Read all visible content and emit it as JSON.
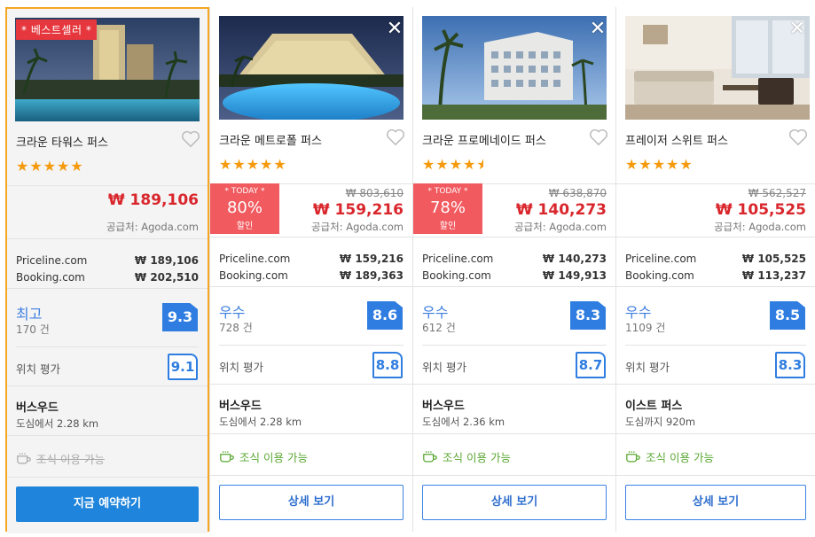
{
  "colors": {
    "accent": "#2f7de1",
    "price": "#d9262c",
    "highlight_border": "#f5a623",
    "today_badge": "#f15a5f",
    "breakfast": "#5aa832"
  },
  "hotels": [
    {
      "ribbon": "* 베스트셀러 *",
      "name": "크라운 타워스 퍼스",
      "stars": "★★★★★",
      "price_now": "₩ 189,106",
      "supplier": "공급처: Agoda.com",
      "comparisons": [
        {
          "site": "Priceline.com",
          "price": "₩ 189,106"
        },
        {
          "site": "Booking.com",
          "price": "₩ 202,510"
        }
      ],
      "rating_label": "최고",
      "review_count": "170 건",
      "score": "9.3",
      "location_label": "위치 평가",
      "location_score": "9.1",
      "area": "버스우드",
      "distance": "도심에서 2.28 km",
      "breakfast": "조식 이용 가능",
      "button": "지금 예약하기"
    },
    {
      "name": "크라운 메트로폴 퍼스",
      "stars": "★★★★★",
      "today_label": "* TODAY *",
      "discount": "80%",
      "discount_word": "할인",
      "price_old": "₩ 803,610",
      "price_now": "₩ 159,216",
      "supplier": "공급처: Agoda.com",
      "comparisons": [
        {
          "site": "Priceline.com",
          "price": "₩ 159,216"
        },
        {
          "site": "Booking.com",
          "price": "₩ 189,363"
        }
      ],
      "rating_label": "우수",
      "review_count": "728 건",
      "score": "8.6",
      "location_label": "위치 평가",
      "location_score": "8.8",
      "area": "버스우드",
      "distance": "도심에서 2.28 km",
      "breakfast": "조식 이용 가능",
      "button": "상세 보기"
    },
    {
      "name": "크라운 프로메네이드 퍼스",
      "stars": "★★★★",
      "stars_half": "★",
      "today_label": "* TODAY *",
      "discount": "78%",
      "discount_word": "할인",
      "price_old": "₩ 638,870",
      "price_now": "₩ 140,273",
      "supplier": "공급처: Agoda.com",
      "comparisons": [
        {
          "site": "Priceline.com",
          "price": "₩ 140,273"
        },
        {
          "site": "Booking.com",
          "price": "₩ 149,913"
        }
      ],
      "rating_label": "우수",
      "review_count": "612 건",
      "score": "8.3",
      "location_label": "위치 평가",
      "location_score": "8.7",
      "area": "버스우드",
      "distance": "도심에서 2.36 km",
      "breakfast": "조식 이용 가능",
      "button": "상세 보기"
    },
    {
      "name": "프레이저 스위트 퍼스",
      "stars": "★★★★★",
      "price_old": "₩ 562,527",
      "price_now": "₩ 105,525",
      "supplier": "공급처: Agoda.com",
      "comparisons": [
        {
          "site": "Priceline.com",
          "price": "₩ 105,525"
        },
        {
          "site": "Booking.com",
          "price": "₩ 113,237"
        }
      ],
      "rating_label": "우수",
      "review_count": "1109 건",
      "score": "8.5",
      "location_label": "위치 평가",
      "location_score": "8.3",
      "area": "이스트 퍼스",
      "distance": "도심까지 920m",
      "breakfast": "조식 이용 가능",
      "button": "상세 보기"
    }
  ]
}
